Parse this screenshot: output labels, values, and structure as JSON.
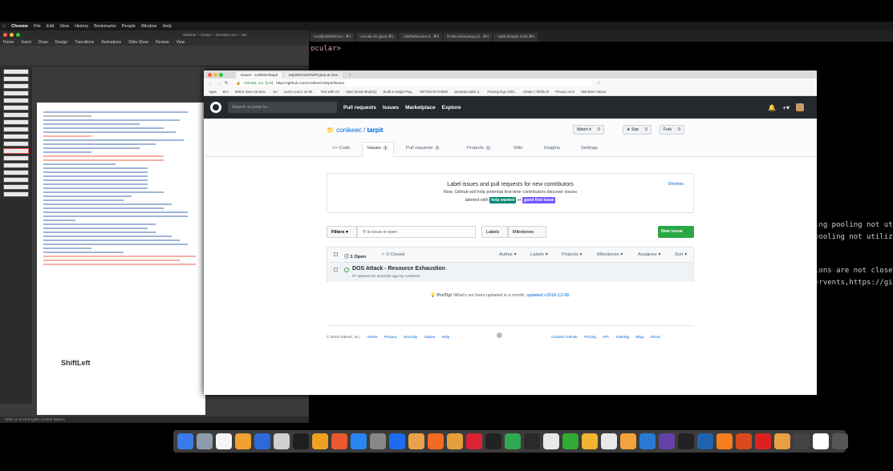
{
  "menubar": {
    "app": "Chrome",
    "items": [
      "File",
      "Edit",
      "View",
      "History",
      "Bookmarks",
      "People",
      "Window",
      "Help"
    ]
  },
  "presentation": {
    "tabs": [
      "Home",
      "Insert",
      "Draw",
      "Design",
      "Transitions",
      "Animations",
      "Slide Show",
      "Review",
      "View"
    ],
    "status": "Slide 12 of 18   English (United States)",
    "logo": "ShiftLeft",
    "window_title": "Webinar -- Ocular -- DevOps.com -- Jan"
  },
  "terminal": {
    "tabs": [
      "root@a3f60b2ca4..  ⌘1",
      "~/ocular-sh (java)  ⌘2",
      "../shiftleft/ocular-d..  ⌘3",
      "/Public/sample/pg (S..  ⌘4",
      "~/github/tarpit (zsh)  ⌘5"
    ],
    "prompt": "ocular>",
    "lines": [
      "ing pooling not ut",
      "pooling not utilize",
      "ions are not close",
      "ervents,https://gi"
    ]
  },
  "browser": {
    "tabs": [
      "Issues · conikeec/tarpit",
      "tarpit/ServletTarPit.java at mas",
      "+"
    ],
    "url_secure": "GitHub, Inc. [US]",
    "url": "https://github.com/conikeec/tarpit/issues",
    "bookmarks": [
      "Apps",
      "Bcc",
      "BNnS Java Genera..",
      "So",
      "Learn Lua in 15 Mi..",
      "Text with Go",
      "dave (Dave Brophy)",
      "Build a Single-Pag..",
      "NETGEAR D3906",
      "JavaSpecialist 2..",
      "Parsing logs 230x..",
      "chatan | ShiftLeft",
      "Privacy error",
      "Manhiam Vasan.."
    ]
  },
  "github": {
    "search_placeholder": "Search or jump to...",
    "nav": [
      "Pull requests",
      "Issues",
      "Marketplace",
      "Explore"
    ],
    "owner": "conikeec",
    "repo": "tarpit",
    "watch": {
      "label": "Watch ▾",
      "count": "0"
    },
    "star": {
      "label": "★ Star",
      "count": "0"
    },
    "fork": {
      "label": "Fork",
      "count": "0"
    },
    "repo_tabs": [
      {
        "label": "<> Code",
        "count": ""
      },
      {
        "label": "Issues",
        "count": "1"
      },
      {
        "label": "Pull requests",
        "count": "0"
      },
      {
        "label": "Projects",
        "count": "0"
      },
      {
        "label": "Wiki",
        "count": ""
      },
      {
        "label": "Insights",
        "count": ""
      },
      {
        "label": "Settings",
        "count": ""
      }
    ],
    "promo": {
      "heading": "Label issues and pull requests for new contributors",
      "text": "Now, GitHub will help potential first-time contributors discover issues",
      "text2_pre": "labeled with",
      "label1": "help wanted",
      "label1_color": "#008672",
      "or": "or",
      "label2": "good first issue",
      "label2_color": "#7057ff",
      "dismiss": "Dismiss"
    },
    "filters_label": "Filters ▾",
    "filter_value": "is:issue is:open",
    "labels_btn": "Labels",
    "milestones_btn": "Milestones",
    "new_issue": "New issue",
    "list_header": {
      "open": "1 Open",
      "closed": "✓ 0 Closed",
      "author": "Author ▾",
      "labels": "Labels ▾",
      "projects": "Projects ▾",
      "milestones": "Milestones ▾",
      "assignee": "Assignee ▾",
      "sort": "Sort ▾"
    },
    "issue": {
      "title": "DOS Attack - Resource Exhaustion",
      "meta": "#7 opened 31 seconds ago by conikeec"
    },
    "protip": {
      "label": "ProTip!",
      "text": "What's not been updated in a month:",
      "link": "updated:<2018-12-08."
    },
    "footer": {
      "copyright": "© 2019 GitHub, Inc.",
      "left": [
        "Terms",
        "Privacy",
        "Security",
        "Status",
        "Help"
      ],
      "right": [
        "Contact GitHub",
        "Pricing",
        "API",
        "Training",
        "Blog",
        "About"
      ]
    }
  },
  "dock_colors": [
    "#3b7be8",
    "#8d9cad",
    "#f5f5f5",
    "#f0a030",
    "#2d6ad8",
    "#d0d0d0",
    "#1e1e1e",
    "#f0a020",
    "#ea5a30",
    "#2b86f3",
    "#888",
    "#1d6cf0",
    "#e9a24a",
    "#f26b21",
    "#e3a03a",
    "#d23",
    "#222",
    "#32a852",
    "#2a2a2a",
    "#e8e8e8",
    "#3a3",
    "#f2b431",
    "#e8e8e8",
    "#f2a33c",
    "#2a7ad5",
    "#6441a5",
    "#222",
    "#2062b0",
    "#f57f20",
    "#d84a1b",
    "#e02020",
    "#e8a040",
    "#444",
    "#fff",
    "#555"
  ]
}
